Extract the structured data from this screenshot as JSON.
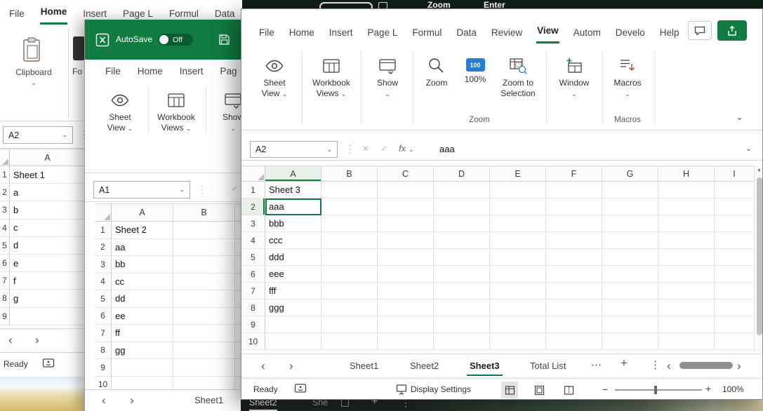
{
  "glyphs": {
    "chevron_down": "⌄",
    "prev": "‹",
    "next": "›",
    "more": "⋯",
    "vdots": "⋮",
    "plus": "+",
    "minus": "−",
    "cancel": "✕",
    "confirm": "✓",
    "up_arrow": "▲"
  },
  "screen_top_bar": {
    "fragment_left": "Zoom",
    "fragment_right": "Enter"
  },
  "background_tab_strip": {
    "active_tab": "Sheet2",
    "partial_tab": "She"
  },
  "back_window": {
    "ribbon_tabs": [
      {
        "label": "File"
      },
      {
        "label": "Home"
      },
      {
        "label": "Insert"
      },
      {
        "label": "Page L"
      },
      {
        "label": "Formul"
      },
      {
        "label": "Data"
      }
    ],
    "active_tab": "Home",
    "clipboard_group": {
      "label": "Clipboard"
    },
    "font_group_partial": "Fo",
    "name_box_value": "A2",
    "grid": {
      "column_header": "A",
      "rows": [
        {
          "num": "1",
          "value": "Sheet 1"
        },
        {
          "num": "2",
          "value": "a"
        },
        {
          "num": "3",
          "value": "b"
        },
        {
          "num": "4",
          "value": "c"
        },
        {
          "num": "5",
          "value": "d"
        },
        {
          "num": "6",
          "value": "e"
        },
        {
          "num": "7",
          "value": "f"
        },
        {
          "num": "8",
          "value": "g"
        },
        {
          "num": "9",
          "value": ""
        }
      ]
    },
    "status_bar": {
      "ready": "Ready"
    }
  },
  "middle_window": {
    "title_bar": {
      "autosave_label": "AutoSave",
      "autosave_state": "Off"
    },
    "ribbon_tabs": [
      {
        "label": "File"
      },
      {
        "label": "Home"
      },
      {
        "label": "Insert"
      },
      {
        "label": "Pag"
      }
    ],
    "ribbon_buttons": {
      "sheet_view_line1": "Sheet",
      "sheet_view_line2": "View",
      "workbook_views_line1": "Workbook",
      "workbook_views_line2": "Views",
      "show_label": "Show"
    },
    "name_box_value": "A1",
    "grid": {
      "column_headers": [
        "A",
        "B"
      ],
      "rows": [
        {
          "num": "1",
          "value": "Sheet 2"
        },
        {
          "num": "2",
          "value": "aa"
        },
        {
          "num": "3",
          "value": "bb"
        },
        {
          "num": "4",
          "value": "cc"
        },
        {
          "num": "5",
          "value": "dd"
        },
        {
          "num": "6",
          "value": "ee"
        },
        {
          "num": "7",
          "value": "ff"
        },
        {
          "num": "8",
          "value": "gg"
        },
        {
          "num": "9",
          "value": ""
        },
        {
          "num": "10",
          "value": ""
        }
      ]
    },
    "sheet_tab_bar": {
      "tab": "Sheet1"
    }
  },
  "front_window": {
    "ribbon_tabs": [
      {
        "label": "File"
      },
      {
        "label": "Home"
      },
      {
        "label": "Insert"
      },
      {
        "label": "Page L"
      },
      {
        "label": "Formul"
      },
      {
        "label": "Data"
      },
      {
        "label": "Review"
      },
      {
        "label": "View"
      },
      {
        "label": "Autom"
      },
      {
        "label": "Develo"
      },
      {
        "label": "Help"
      }
    ],
    "active_tab": "View",
    "ribbon_buttons": {
      "sheet_view_line1": "Sheet",
      "sheet_view_line2": "View",
      "workbook_views_line1": "Workbook",
      "workbook_views_line2": "Views",
      "show_label": "Show",
      "zoom_label": "Zoom",
      "hundred_label": "100%",
      "hundred_icon_text": "100",
      "zoom_to_selection_line1": "Zoom to",
      "zoom_to_selection_line2": "Selection",
      "window_label": "Window",
      "macros_label": "Macros"
    },
    "ribbon_group_labels": {
      "zoom": "Zoom",
      "macros": "Macros"
    },
    "formula_bar": {
      "name_box_value": "A2",
      "fx_label": "fx",
      "value": "aaa"
    },
    "grid": {
      "column_headers": [
        "A",
        "B",
        "C",
        "D",
        "E",
        "F",
        "G",
        "H",
        "I"
      ],
      "selected_cell": "A2",
      "rows": [
        {
          "num": "1",
          "value": "Sheet 3"
        },
        {
          "num": "2",
          "value": "aaa"
        },
        {
          "num": "3",
          "value": "bbb"
        },
        {
          "num": "4",
          "value": "ccc"
        },
        {
          "num": "5",
          "value": "ddd"
        },
        {
          "num": "6",
          "value": "eee"
        },
        {
          "num": "7",
          "value": "fff"
        },
        {
          "num": "8",
          "value": "ggg"
        },
        {
          "num": "9",
          "value": ""
        },
        {
          "num": "10",
          "value": ""
        }
      ]
    },
    "sheet_tab_bar": {
      "tabs": [
        {
          "label": "Sheet1"
        },
        {
          "label": "Sheet2"
        },
        {
          "label": "Sheet3",
          "active": true
        },
        {
          "label": "Total List"
        }
      ]
    },
    "status_bar": {
      "ready": "Ready",
      "display_settings": "Display Settings",
      "zoom_percent": "100%"
    }
  }
}
